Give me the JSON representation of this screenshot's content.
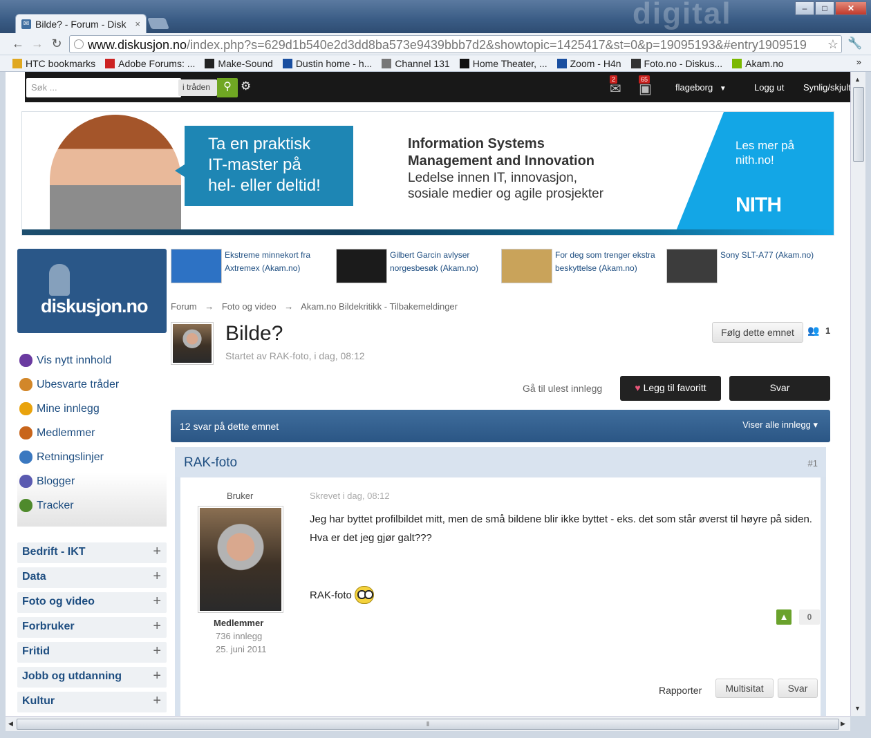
{
  "browser": {
    "tab_title": "Bilde? - Forum - Disk",
    "tab_close": "×",
    "url_host": "www.diskusjon.no",
    "url_path": "/index.php?s=629d1b540e2d3dd8ba573e9439bbb7d2&showtopic=1425417&st=0&p=19095193&#entry1909519",
    "watermark": "digital",
    "bookmarks": [
      {
        "label": "HTC bookmarks",
        "icon": "folder-icon",
        "color": "#e0a820"
      },
      {
        "label": "Adobe Forums: ...",
        "icon": "adobe-icon",
        "color": "#cc2222"
      },
      {
        "label": "Make-Sound",
        "icon": "makesound-icon",
        "color": "#222222"
      },
      {
        "label": "Dustin home - h...",
        "icon": "dustin-icon",
        "color": "#1a4fa0"
      },
      {
        "label": "Channel 131",
        "icon": "globe-icon",
        "color": "#777777"
      },
      {
        "label": "Home Theater, ...",
        "icon": "hometheater-icon",
        "color": "#111111"
      },
      {
        "label": "Zoom - H4n",
        "icon": "zoom-icon",
        "color": "#1a4fa0"
      },
      {
        "label": "Foto.no - Diskus...",
        "icon": "foto-icon",
        "color": "#333333"
      },
      {
        "label": "Akam.no",
        "icon": "akam-icon",
        "color": "#7ab800"
      }
    ],
    "bookmarks_more": "»"
  },
  "site": {
    "search_placeholder": "Søk ...",
    "search_scope": "i tråden",
    "messages_count": "2",
    "notifications_count": "65",
    "username": "flageborg",
    "logout": "Logg ut",
    "visibility": "Synlig/skjult"
  },
  "banner": {
    "headline": [
      "Ta en praktisk",
      "IT-master på",
      "hel- eller deltid!"
    ],
    "program_line1": "Information Systems",
    "program_line2": "Management and Innovation",
    "desc_line1": "Ledelse innen IT, innovasjon,",
    "desc_line2": "sosiale medier og agile prosjekter",
    "cta_line1": "Les mer på",
    "cta_line2": "nith.no!",
    "logo": "NITH"
  },
  "sidebar": {
    "logo": "diskusjon.no",
    "menu": [
      {
        "label": "Vis nytt innhold",
        "icon": "clock-icon",
        "color": "#6a3aa0"
      },
      {
        "label": "Ubesvarte tråder",
        "icon": "envelope-icon",
        "color": "#d2872a"
      },
      {
        "label": "Mine innlegg",
        "icon": "smiley-icon",
        "color": "#e9a30d"
      },
      {
        "label": "Medlemmer",
        "icon": "members-icon",
        "color": "#c8651b"
      },
      {
        "label": "Retningslinjer",
        "icon": "rules-icon",
        "color": "#3a78c0"
      },
      {
        "label": "Blogger",
        "icon": "blog-icon",
        "color": "#5a5ab0"
      },
      {
        "label": "Tracker",
        "icon": "tracker-icon",
        "color": "#4f8a2c"
      }
    ],
    "categories": [
      "Bedrift - IKT",
      "Data",
      "Foto og video",
      "Forbruker",
      "Fritid",
      "Jobb og utdanning",
      "Kultur"
    ]
  },
  "promos": [
    {
      "text": "Ekstreme minnekort fra Axtremex (Akam.no)",
      "color": "#2d72c4"
    },
    {
      "text": "Gilbert Garcin avlyser norgesbesøk (Akam.no)",
      "color": "#1b1b1b"
    },
    {
      "text": "For deg som trenger ekstra beskyttelse (Akam.no)",
      "color": "#c9a35a"
    },
    {
      "text": "Sony SLT-A77 (Akam.no)",
      "color": "#3c3c3c"
    }
  ],
  "breadcrumb": [
    "Forum",
    "Foto og video",
    "Akam.no Bildekritikk - Tilbakemeldinger"
  ],
  "breadcrumb_sep": "→",
  "topic": {
    "title": "Bilde?",
    "started": "Startet av RAK-foto, i dag, 08:12",
    "follow": "Følg dette emnet",
    "followers": "1",
    "goto_unread": "Gå til ulest innlegg",
    "favorite": "Legg til favoritt",
    "reply": "Svar",
    "replies_count": "12 svar på dette emnet",
    "view_mode": "Viser alle innlegg ▾"
  },
  "post": {
    "author": "RAK-foto",
    "number": "#1",
    "role": "Bruker",
    "group": "Medlemmer",
    "posts": "736 innlegg",
    "joined": "25. juni 2011",
    "posted": "Skrevet i dag, 08:12",
    "body_line1": "Jeg har byttet profilbildet mitt, men de små bildene blir ikke byttet - eks. det som står øverst til høyre på siden.",
    "body_line2": "Hva er det jeg gjør galt???",
    "signature": "RAK-foto",
    "votes": "0",
    "report": "Rapporter",
    "multiquote": "Multisitat",
    "reply": "Svar"
  }
}
